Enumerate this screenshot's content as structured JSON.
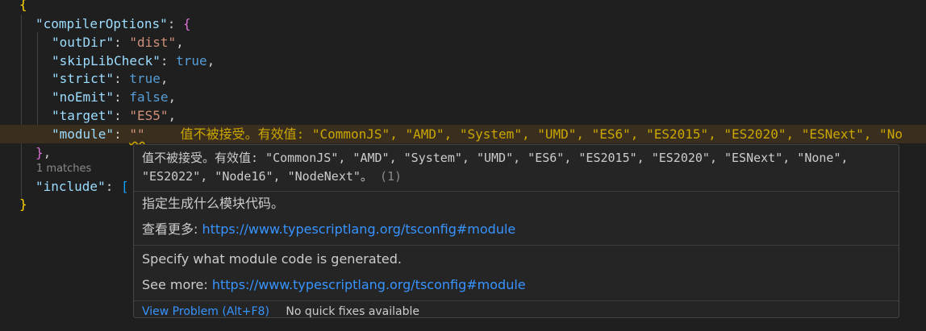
{
  "code": {
    "open_brace": "{",
    "compiler_options_key": "\"compilerOptions\"",
    "outdir_key": "\"outDir\"",
    "outdir_value": "\"dist\"",
    "skiplibcheck_key": "\"skipLibCheck\"",
    "skiplibcheck_value": "true",
    "strict_key": "\"strict\"",
    "strict_value": "true",
    "noemit_key": "\"noEmit\"",
    "noemit_value": "false",
    "target_key": "\"target\"",
    "target_value": "\"ES5\"",
    "module_key": "\"module\"",
    "module_value": "\"\"",
    "inline_error": "值不被接受。有效值: \"CommonJS\", \"AMD\", \"System\", \"UMD\", \"ES6\", \"ES2015\", \"ES2020\", \"ESNext\", \"No",
    "close_inner": "}",
    "include_key": "\"include\"",
    "include_bracket": "[",
    "close_outer": "}"
  },
  "find_hint": "1 matches",
  "hover": {
    "error_message": "值不被接受。有效值: \"CommonJS\", \"AMD\", \"System\", \"UMD\", \"ES6\", \"ES2015\", \"ES2020\", \"ESNext\", \"None\", \"ES2022\", \"Node16\", \"NodeNext\"。",
    "error_count": "(1)",
    "desc_zh": "指定生成什么模块代码。",
    "see_more_zh_label": "查看更多:",
    "link_url": "https://www.typescriptlang.org/tsconfig#module",
    "desc_en": "Specify what module code is generated.",
    "see_more_en_label": "See more:",
    "view_problem": "View Problem (Alt+F8)",
    "no_quick_fixes": "No quick fixes available"
  },
  "colors": {
    "editor_bg": "#1f1f1f",
    "key": "#9cdcfe",
    "string": "#ce9178",
    "keyword": "#569cd6",
    "warning": "#cca700",
    "link": "#3794ff"
  }
}
